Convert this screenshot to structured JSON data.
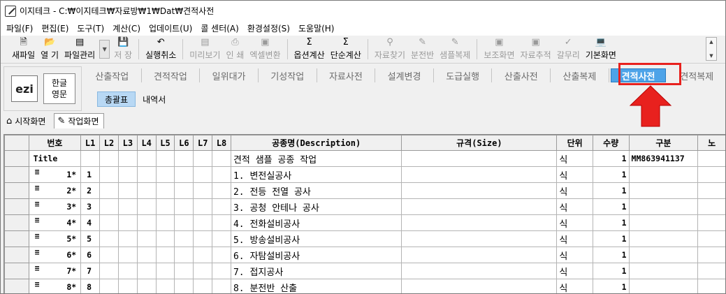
{
  "window": {
    "title": "이지테크 - C:₩이지테크₩자료방₩1₩Dat₩견적사전"
  },
  "menu": [
    "파일(F)",
    "편집(E)",
    "도구(T)",
    "계산(C)",
    "업데이트(U)",
    "콜 센터(A)",
    "환경설정(S)",
    "도움말(H)"
  ],
  "toolbar": {
    "new": "새파일",
    "open": "열 기",
    "file_manage": "파일관리",
    "save": "저 장",
    "undo": "실행취소",
    "preview": "미리보기",
    "print": "인 쇄",
    "excel": "엑셀변환",
    "option_calc": "옵션계산",
    "simple_calc": "단순계산",
    "find": "자료찾기",
    "panel": "분전반",
    "sample_copy": "샘플복제",
    "aux_screen": "보조화면",
    "data_trace": "자료추적",
    "cleanup": "갈무리",
    "home": "기본화면"
  },
  "logo": {
    "text": "ezi",
    "lang_kor": "한글",
    "lang_eng": "영문"
  },
  "tabs": [
    "산출작업",
    "견적작업",
    "일위대가",
    "기성작업",
    "자료사전",
    "설계변경",
    "도급실행",
    "산출사전",
    "산출복제",
    "견적사전",
    "견적복제"
  ],
  "active_tab": "견적사전",
  "subtabs": [
    "총괄표",
    "내역서"
  ],
  "active_subtab": "총괄표",
  "pagetabs": [
    "시작화면",
    "작업화면"
  ],
  "active_pagetab": "작업화면",
  "grid": {
    "columns": [
      "번호",
      "L1",
      "L2",
      "L3",
      "L4",
      "L5",
      "L6",
      "L7",
      "L8",
      "공종명(Description)",
      "규격(Size)",
      "단위",
      "수량",
      "구분",
      "노"
    ],
    "title_row": {
      "label": "Title",
      "desc": "견적 샘플 공종 작업",
      "unit": "식",
      "qty": "1",
      "code": "MM863941137"
    },
    "rows": [
      {
        "no": "1*",
        "l1": "1",
        "desc": "1. 변전실공사",
        "unit": "식",
        "qty": "1"
      },
      {
        "no": "2*",
        "l1": "2",
        "desc": "2. 전등 전열 공사",
        "unit": "식",
        "qty": "1"
      },
      {
        "no": "3*",
        "l1": "3",
        "desc": "3. 공청 안테나 공사",
        "unit": "식",
        "qty": "1"
      },
      {
        "no": "4*",
        "l1": "4",
        "desc": "4. 전화설비공사",
        "unit": "식",
        "qty": "1"
      },
      {
        "no": "5*",
        "l1": "5",
        "desc": "5. 방송설비공사",
        "unit": "식",
        "qty": "1"
      },
      {
        "no": "6*",
        "l1": "6",
        "desc": "6. 자탐설비공사",
        "unit": "식",
        "qty": "1"
      },
      {
        "no": "7*",
        "l1": "7",
        "desc": "7. 접지공사",
        "unit": "식",
        "qty": "1"
      },
      {
        "no": "8*",
        "l1": "8",
        "desc": "8. 분전반 산출",
        "unit": "식",
        "qty": "1"
      }
    ]
  },
  "colors": {
    "active_tab": "#4da3e8",
    "highlight": "#e8211e",
    "arrow": "#e8211e"
  },
  "icons": [
    "app-icon",
    "new-file-icon",
    "open-folder-icon",
    "file-manage-icon",
    "save-icon",
    "undo-icon",
    "preview-icon",
    "print-icon",
    "excel-icon",
    "sigma-icon",
    "find-icon",
    "panel-icon",
    "sample-copy-icon",
    "check-icon",
    "home-monitor-icon",
    "home-icon",
    "work-screen-icon",
    "red-arrow-up-icon"
  ]
}
